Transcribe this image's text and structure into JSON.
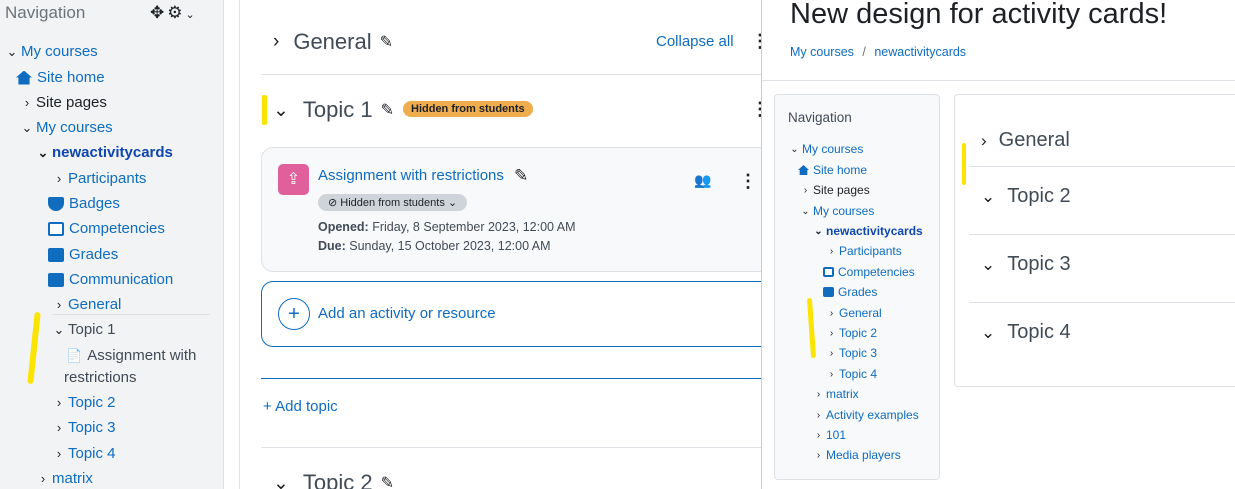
{
  "left_nav": {
    "title": "Navigation",
    "items": [
      {
        "label": "My courses"
      },
      {
        "label": "Site home"
      },
      {
        "label": "Site pages"
      },
      {
        "label": "My courses"
      },
      {
        "label": "newactivitycards"
      },
      {
        "label": "Participants"
      },
      {
        "label": "Badges"
      },
      {
        "label": "Competencies"
      },
      {
        "label": "Grades"
      },
      {
        "label": "Communication"
      },
      {
        "label": "General"
      },
      {
        "label": "Topic 1"
      },
      {
        "label": "Assignment with"
      },
      {
        "label": "restrictions"
      },
      {
        "label": "Topic 2"
      },
      {
        "label": "Topic 3"
      },
      {
        "label": "Topic 4"
      },
      {
        "label": "matrix"
      }
    ]
  },
  "main": {
    "general_title": "General",
    "collapse_all": "Collapse all",
    "topic1_title": "Topic 1",
    "hidden_badge": "Hidden from students",
    "activity": {
      "name": "Assignment with restrictions",
      "hidden_label": "Hidden from students",
      "opened_label": "Opened:",
      "opened_value": "Friday, 8 September 2023, 12:00 AM",
      "due_label": "Due:",
      "due_value": "Sunday, 15 October 2023, 12:00 AM"
    },
    "add_activity": "Add an activity or resource",
    "add_topic": "Add topic",
    "topic2_title": "Topic 2"
  },
  "right_panel": {
    "page_title": "New design for activity cards!",
    "breadcrumb": [
      "My courses",
      "/",
      "newactivitycards"
    ],
    "nav_title": "Navigation",
    "nav_items": [
      {
        "label": "My courses"
      },
      {
        "label": "Site home"
      },
      {
        "label": "Site pages"
      },
      {
        "label": "My courses"
      },
      {
        "label": "newactivitycards"
      },
      {
        "label": "Participants"
      },
      {
        "label": "Competencies"
      },
      {
        "label": "Grades"
      },
      {
        "label": "General"
      },
      {
        "label": "Topic 2"
      },
      {
        "label": "Topic 3"
      },
      {
        "label": "Topic 4"
      },
      {
        "label": "matrix"
      },
      {
        "label": "Activity examples"
      },
      {
        "label": "101"
      },
      {
        "label": "Media players"
      }
    ],
    "sections": [
      "General",
      "Topic 2",
      "Topic 3",
      "Topic 4"
    ]
  },
  "colors": {
    "link": "#0f6cbf",
    "badge": "#f0ad4e",
    "highlight": "#fbe400",
    "assign_icon": "#e0609b"
  }
}
